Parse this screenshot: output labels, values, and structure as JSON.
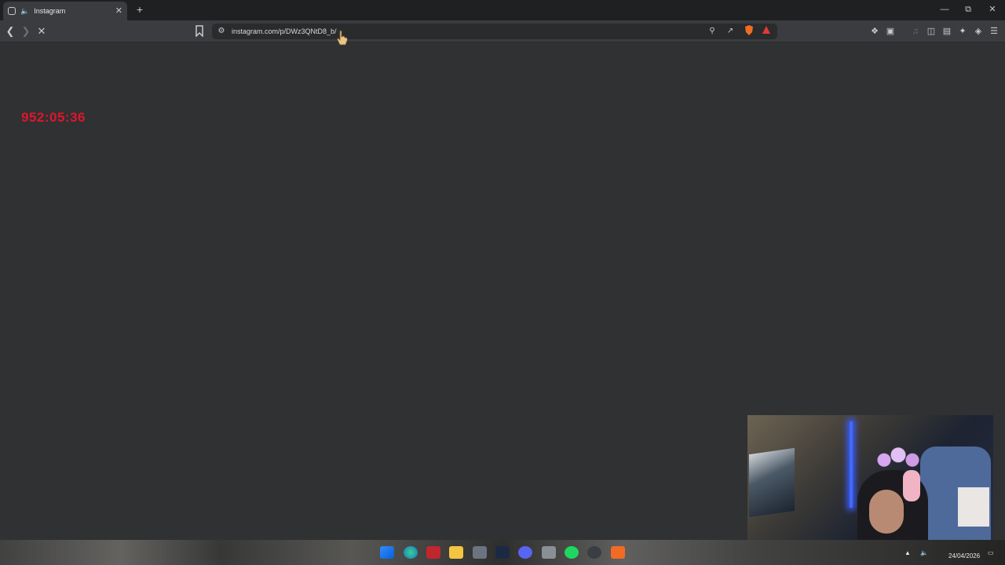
{
  "browser": {
    "tab": {
      "title": "Instagram"
    },
    "address_bar": {
      "url": "instagram.com/p/DWz3QNtD8_b/"
    }
  },
  "page": {
    "timer_text": "952:05:36"
  },
  "taskbar": {
    "date": "24/04/2026"
  },
  "colors": {
    "page_background": "#2f3133",
    "timer": "#e0152a",
    "toolbar": "#3a3c3f",
    "tabstrip": "#1f2022"
  }
}
